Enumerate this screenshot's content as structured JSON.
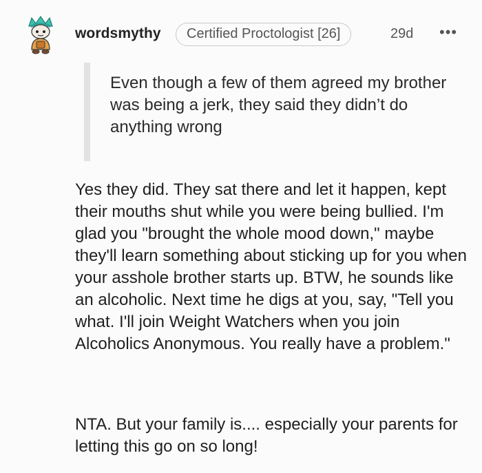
{
  "comment": {
    "username": "wordsmythy",
    "flair": "Certified Proctologist [26]",
    "age": "29d",
    "more_icon": "more-horizontal-icon",
    "avatar_icon": "snoo-avatar-icon",
    "quote": "Even though a few of them agreed my brother was being a jerk, they said they didn’t do anything wrong",
    "paragraphs": [
      "Yes they did. They sat there and let it happen, kept their mouths shut while you were being bullied. I'm glad you \"brought the whole mood down,\" maybe they'll learn something about sticking up for you when your asshole brother starts up. BTW, he sounds like an alcoholic. Next time he digs at you, say, \"Tell you what. I'll join Weight Watchers when you join Alcoholics Anonymous. You really have a problem.\"",
      "NTA. But your family is.... especially your parents for letting this go on so long!"
    ]
  },
  "colors": {
    "background": "#fbfbfb",
    "text": "#1c1c1c",
    "meta": "#555555",
    "quote_bar": "#e2e2e2",
    "avatar_accent": "#3fbfb0"
  }
}
